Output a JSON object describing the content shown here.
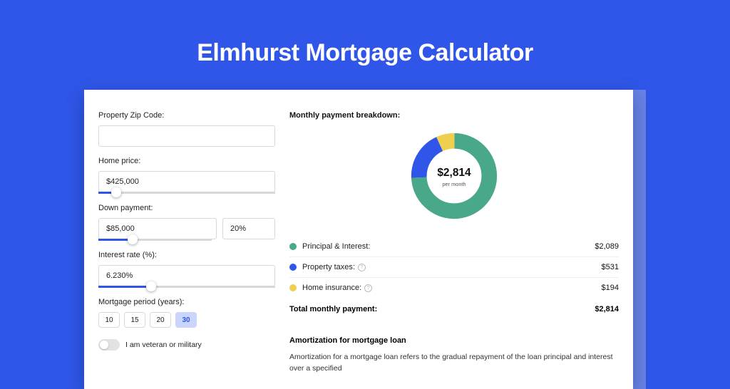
{
  "title": "Elmhurst Mortgage Calculator",
  "form": {
    "zip_label": "Property Zip Code:",
    "zip_value": "",
    "home_price_label": "Home price:",
    "home_price_value": "$425,000",
    "home_price_slider_pct": 10,
    "down_payment_label": "Down payment:",
    "down_payment_value": "$85,000",
    "down_payment_pct_value": "20%",
    "down_payment_slider_pct": 20,
    "interest_label": "Interest rate (%):",
    "interest_value": "6.230%",
    "interest_slider_pct": 30,
    "period_label": "Mortgage period (years):",
    "periods": [
      "10",
      "15",
      "20",
      "30"
    ],
    "period_selected_index": 3,
    "veteran_label": "I am veteran or military"
  },
  "breakdown": {
    "title": "Monthly payment breakdown:",
    "donut_value": "$2,814",
    "donut_sub": "per month",
    "items": [
      {
        "label": "Principal & Interest:",
        "value": "$2,089",
        "color": "#48a889",
        "info": false
      },
      {
        "label": "Property taxes:",
        "value": "$531",
        "color": "#2f56e8",
        "info": true
      },
      {
        "label": "Home insurance:",
        "value": "$194",
        "color": "#efcf4f",
        "info": true
      }
    ],
    "total_label": "Total monthly payment:",
    "total_value": "$2,814"
  },
  "chart_data": {
    "type": "pie",
    "title": "Monthly payment breakdown",
    "series": [
      {
        "name": "Principal & Interest",
        "value": 2089,
        "color": "#48a889"
      },
      {
        "name": "Property taxes",
        "value": 531,
        "color": "#2f56e8"
      },
      {
        "name": "Home insurance",
        "value": 194,
        "color": "#efcf4f"
      }
    ],
    "total": 2814,
    "center_label": "$2,814 per month"
  },
  "amort": {
    "title": "Amortization for mortgage loan",
    "text": "Amortization for a mortgage loan refers to the gradual repayment of the loan principal and interest over a specified"
  }
}
